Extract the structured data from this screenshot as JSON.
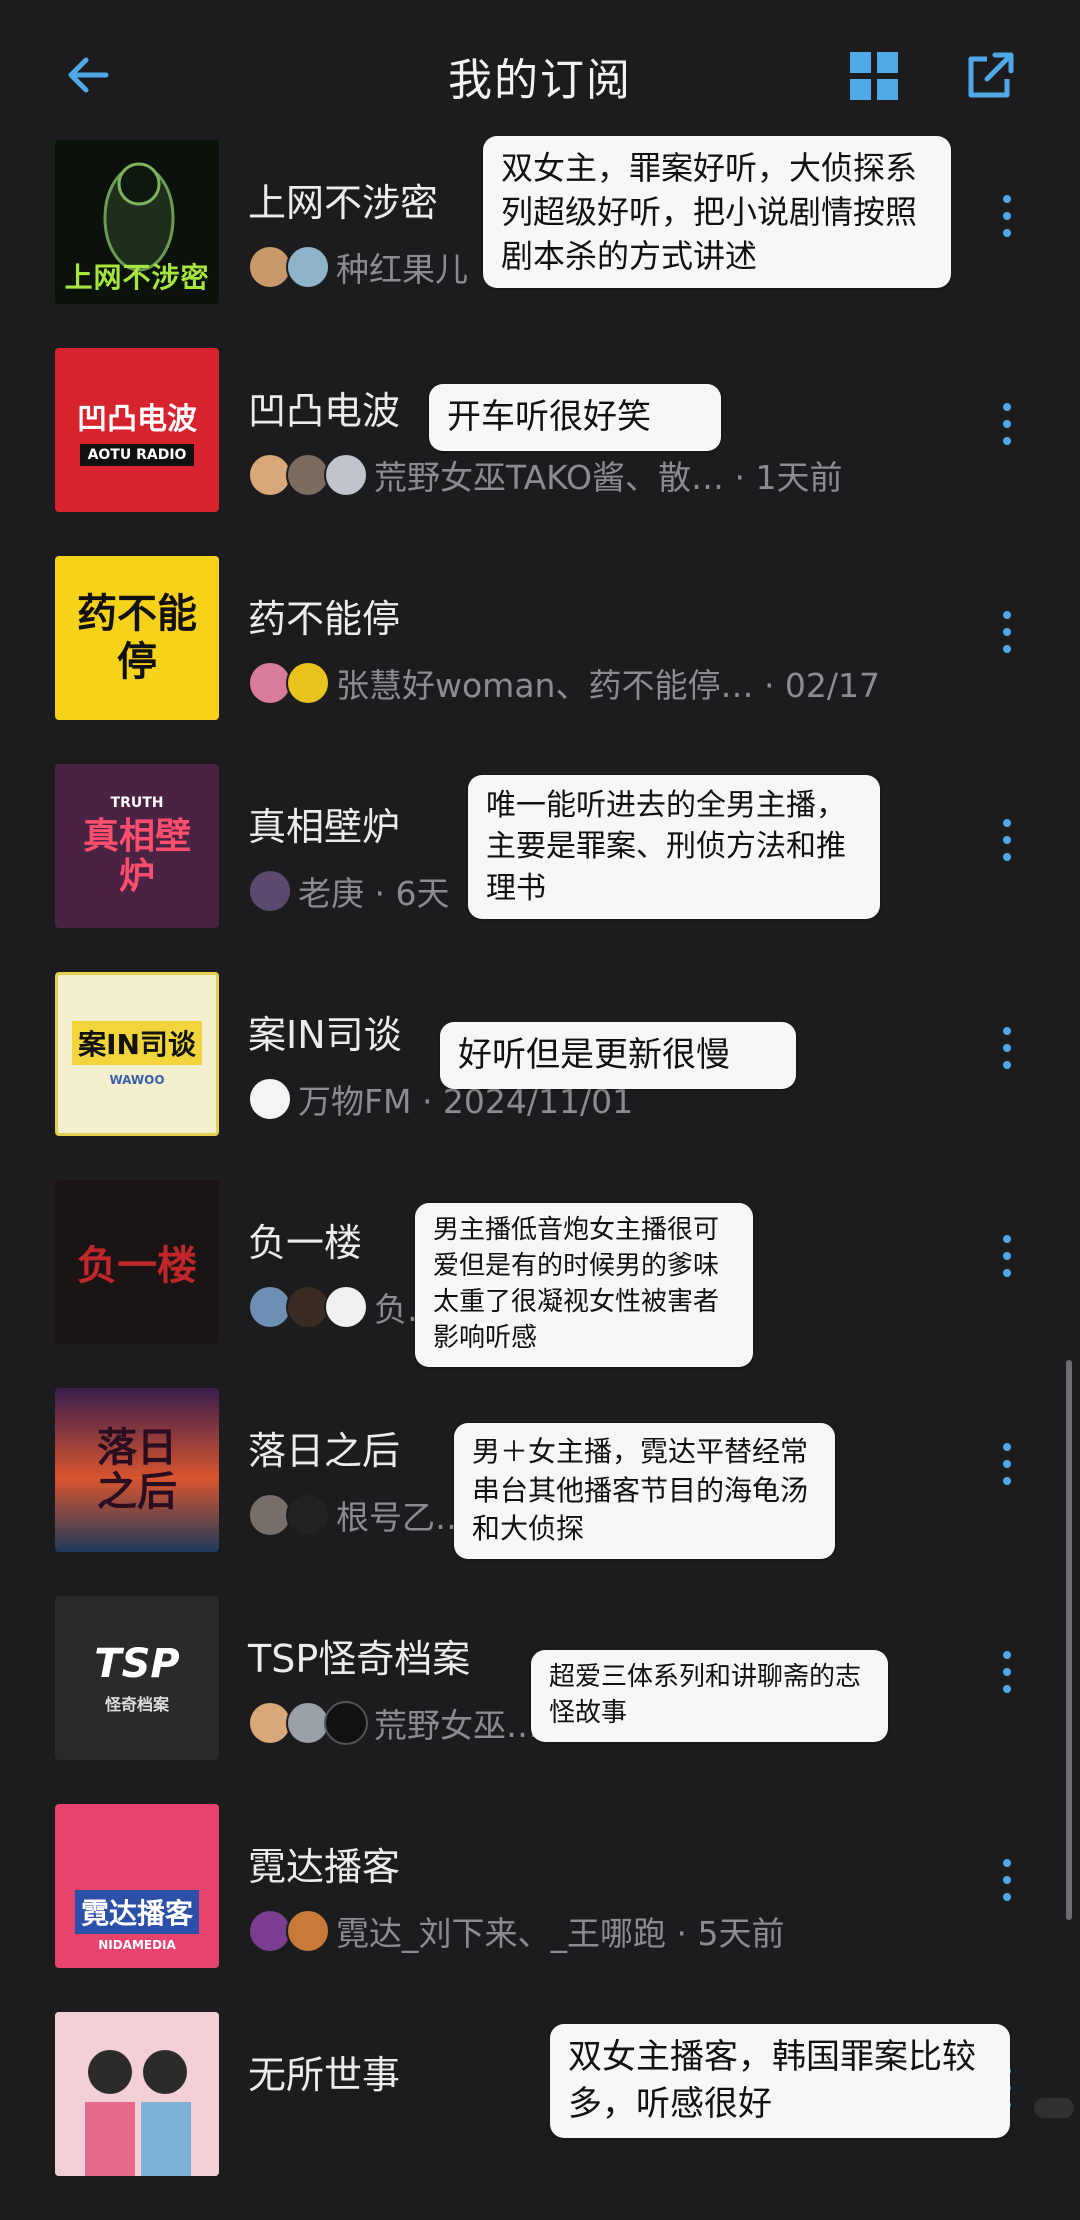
{
  "header": {
    "title": "我的订阅",
    "back_icon": "back-arrow-icon",
    "grid_icon": "grid-view-icon",
    "share_icon": "external-link-icon",
    "accent": "#4fa9e6"
  },
  "podcasts": [
    {
      "name": "上网不涉密",
      "meta": "种红果儿",
      "note": "双女主，罪案好听，大侦探系列超级好听，把小说剧情按照剧本杀的方式讲述",
      "cover_text": "上网不涉密"
    },
    {
      "name": "凹凸电波",
      "meta": "荒野女巫TAKO酱、散…  · 1天前",
      "note": "开车听很好笑",
      "cover_text": "凹凸电波",
      "cover_sub": "AOTU RADIO"
    },
    {
      "name": "药不能停",
      "meta": "张慧好woman、药不能停…  · 02/17",
      "note": "",
      "cover_text": "药不能停"
    },
    {
      "name": "真相壁炉",
      "meta": "老庚 · 6天",
      "note": "唯一能听进去的全男主播，主要是罪案、刑侦方法和推理书",
      "cover_text": "真相壁炉",
      "cover_sub": "TRUTH"
    },
    {
      "name": "案IN司谈",
      "meta": "万物FM · 2024/11/01",
      "note": "好听但是更新很慢",
      "cover_text": "案IN司谈",
      "cover_sub": "WAWOO"
    },
    {
      "name": "负一楼",
      "meta": "负…  · 1天前",
      "note": "男主播低音炮女主播很可爱但是有的时候男的爹味太重了很凝视女性被害者影响听感",
      "cover_text": "负一楼"
    },
    {
      "name": "落日之后",
      "meta": "根号乙…  8小时前",
      "note": "男＋女主播，霓达平替经常串台其他播客节目的海龟汤和大侦探",
      "cover_text": "落日之后"
    },
    {
      "name": "TSP怪奇档案",
      "meta": "荒野女巫…  微…  · 5天前",
      "note": "超爱三体系列和讲聊斋的志怪故事",
      "cover_text": "TSP",
      "cover_sub": "怪奇档案"
    },
    {
      "name": "霓达播客",
      "meta": "霓达_刘下来、_王哪跑 · 5天前",
      "note": "",
      "cover_text": "霓达播客",
      "cover_sub": "NIDAMEDIA"
    },
    {
      "name": "无所世事",
      "meta": "",
      "note": "双女主播客，韩国罪案比较多，听感很好",
      "cover_text": ""
    }
  ]
}
